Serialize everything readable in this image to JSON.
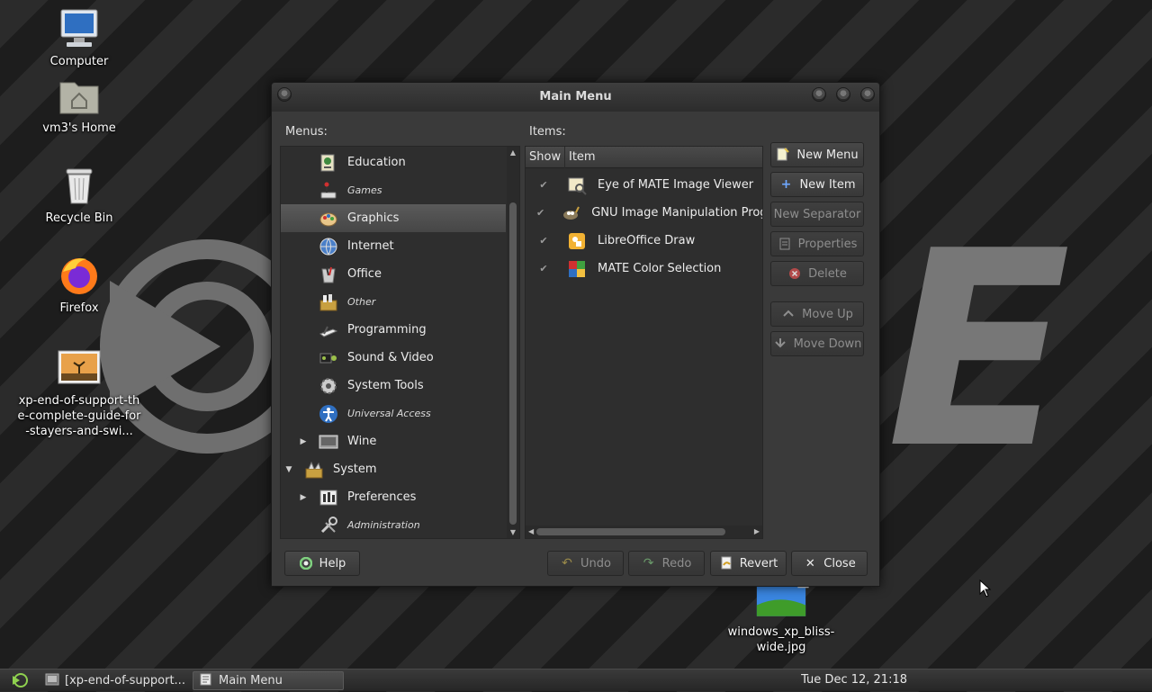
{
  "desktop": {
    "icons": [
      {
        "label": "Computer",
        "icon": "computer-icon"
      },
      {
        "label": "vm3's Home",
        "icon": "home-folder-icon"
      },
      {
        "label": "Recycle Bin",
        "icon": "trash-icon"
      },
      {
        "label": "Firefox",
        "icon": "firefox-icon"
      },
      {
        "label": "xp-end-of-support-the-complete-guide-for-stayers-and-swi...",
        "icon": "image-file-icon"
      },
      {
        "label": "windows_xp_bliss-wide.jpg",
        "icon": "image-file-icon"
      }
    ],
    "wallpaper_letter": "E"
  },
  "window": {
    "title": "Main Menu",
    "menus_label": "Menus:",
    "items_label": "Items:",
    "menus": [
      {
        "label": "Education",
        "style": "normal",
        "icon": "education-icon",
        "indent": 1,
        "expander": ""
      },
      {
        "label": "Games",
        "style": "small",
        "icon": "games-icon",
        "indent": 1,
        "expander": ""
      },
      {
        "label": "Graphics",
        "style": "normal",
        "icon": "graphics-icon",
        "indent": 1,
        "expander": "",
        "selected": true
      },
      {
        "label": "Internet",
        "style": "normal",
        "icon": "internet-icon",
        "indent": 1,
        "expander": ""
      },
      {
        "label": "Office",
        "style": "normal",
        "icon": "office-icon",
        "indent": 1,
        "expander": ""
      },
      {
        "label": "Other",
        "style": "small",
        "icon": "other-icon",
        "indent": 1,
        "expander": ""
      },
      {
        "label": "Programming",
        "style": "normal",
        "icon": "programming-icon",
        "indent": 1,
        "expander": ""
      },
      {
        "label": "Sound & Video",
        "style": "normal",
        "icon": "sound-video-icon",
        "indent": 1,
        "expander": ""
      },
      {
        "label": "System Tools",
        "style": "normal",
        "icon": "system-tools-icon",
        "indent": 1,
        "expander": ""
      },
      {
        "label": "Universal Access",
        "style": "small",
        "icon": "accessibility-icon",
        "indent": 1,
        "expander": ""
      },
      {
        "label": "Wine",
        "style": "normal",
        "icon": "wine-icon",
        "indent": 1,
        "expander": "collapsed"
      },
      {
        "label": "System",
        "style": "normal",
        "icon": "system-icon",
        "indent": 0,
        "expander": "expanded"
      },
      {
        "label": "Preferences",
        "style": "normal",
        "icon": "preferences-icon",
        "indent": 1,
        "expander": "collapsed"
      },
      {
        "label": "Administration",
        "style": "small",
        "icon": "administration-icon",
        "indent": 1,
        "expander": ""
      }
    ],
    "columns": {
      "show": "Show",
      "item": "Item"
    },
    "items": [
      {
        "label": "Eye of MATE Image Viewer",
        "shown": true,
        "icon": "image-viewer-icon"
      },
      {
        "label": "GNU Image Manipulation Program",
        "shown": true,
        "icon": "gimp-icon"
      },
      {
        "label": "LibreOffice Draw",
        "shown": true,
        "icon": "libreoffice-draw-icon"
      },
      {
        "label": "MATE Color Selection",
        "shown": true,
        "icon": "color-selection-icon"
      }
    ],
    "side_buttons": {
      "new_menu": "New Menu",
      "new_item": "New Item",
      "new_separator": "New Separator",
      "properties": "Properties",
      "delete": "Delete",
      "move_up": "Move Up",
      "move_down": "Move Down"
    },
    "bottom_buttons": {
      "help": "Help",
      "undo": "Undo",
      "redo": "Redo",
      "revert": "Revert",
      "close": "Close"
    }
  },
  "taskbar": {
    "tasks": [
      {
        "label": "[xp-end-of-support..."
      },
      {
        "label": "Main Menu"
      }
    ],
    "clock": "Tue Dec 12, 21:18"
  }
}
